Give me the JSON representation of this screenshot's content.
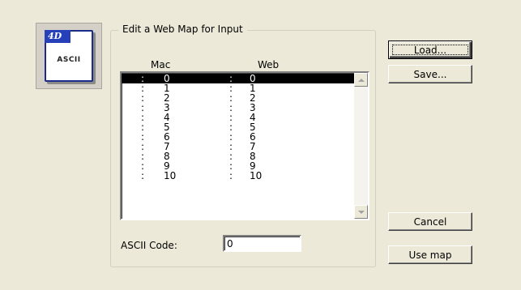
{
  "icon": {
    "name": "4d-ascii-map-icon",
    "tab_text": "4D",
    "label": "ASCII"
  },
  "group": {
    "title": "Edit a Web Map for Input"
  },
  "list": {
    "columns": {
      "mac": "Mac",
      "web": "Web"
    },
    "separator": ":",
    "rows": [
      {
        "mac": "0",
        "web": "0",
        "selected": true
      },
      {
        "mac": "1",
        "web": "1"
      },
      {
        "mac": "2",
        "web": "2"
      },
      {
        "mac": "3",
        "web": "3"
      },
      {
        "mac": "4",
        "web": "4"
      },
      {
        "mac": "5",
        "web": "5"
      },
      {
        "mac": "6",
        "web": "6"
      },
      {
        "mac": "7",
        "web": "7"
      },
      {
        "mac": "8",
        "web": "8"
      },
      {
        "mac": "9",
        "web": "9"
      },
      {
        "mac": "10",
        "web": "10"
      }
    ]
  },
  "ascii": {
    "label": "ASCII Code:",
    "value": "0"
  },
  "buttons": {
    "load": "Load...",
    "save": "Save...",
    "cancel": "Cancel",
    "use_map": "Use map"
  },
  "colors": {
    "dialog_bg": "#ece9d8",
    "selection_bg": "#000000",
    "icon_blue": "#2540b8"
  }
}
